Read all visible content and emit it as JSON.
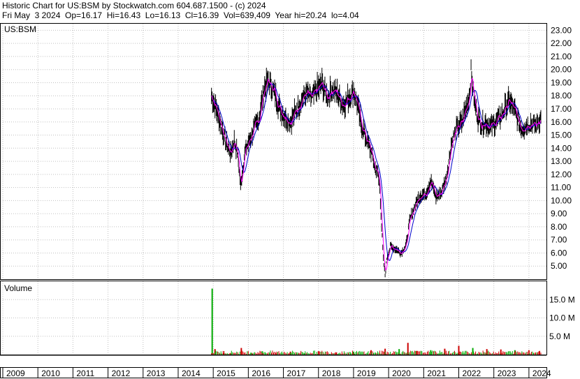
{
  "header": {
    "line1": "Historic Chart for US:BSM by Stockwatch.com 604.687.1500 - (c) 2024",
    "line2": "Fri May  3 2024  Op=16.17  Hi=16.43  Lo=16.13  Cl=16.39  Vol=639,409  Year hi=20.24  lo=4.04"
  },
  "colors": {
    "background": "#ffffff",
    "grid": "#c0c0c0",
    "price_bars": "#000000",
    "ma_short": "#ff00ff",
    "ma_long": "#0000cc",
    "volume_up": "#00aa00",
    "volume_down": "#cc0000"
  },
  "chart_data": [
    {
      "type": "line",
      "title": "US:BSM",
      "ylim": [
        4.0,
        23.5
      ],
      "y_ticks": [
        "23.00",
        "22.00",
        "21.00",
        "20.00",
        "19.00",
        "18.00",
        "17.00",
        "16.00",
        "15.00",
        "14.00",
        "13.00",
        "12.00",
        "11.00",
        "10.00",
        "9.00",
        "8.00",
        "7.00",
        "6.00",
        "5.00"
      ],
      "x_ticks": [
        "2009",
        "2010",
        "2011",
        "2012",
        "2013",
        "2014",
        "2015",
        "2016",
        "2017",
        "2018",
        "2019",
        "2020",
        "2021",
        "2022",
        "2023",
        "2024"
      ],
      "grid": true,
      "series_points": [
        [
          2014.95,
          18.0
        ],
        [
          2015.05,
          17.3
        ],
        [
          2015.2,
          16.0
        ],
        [
          2015.35,
          14.5
        ],
        [
          2015.5,
          13.6
        ],
        [
          2015.6,
          14.6
        ],
        [
          2015.7,
          13.5
        ],
        [
          2015.78,
          11.1
        ],
        [
          2015.9,
          13.7
        ],
        [
          2016.0,
          14.4
        ],
        [
          2016.15,
          15.4
        ],
        [
          2016.3,
          16.2
        ],
        [
          2016.45,
          18.5
        ],
        [
          2016.55,
          19.1
        ],
        [
          2016.65,
          18.8
        ],
        [
          2016.75,
          18.2
        ],
        [
          2016.9,
          17.0
        ],
        [
          2017.05,
          16.4
        ],
        [
          2017.2,
          16.0
        ],
        [
          2017.35,
          16.8
        ],
        [
          2017.5,
          17.6
        ],
        [
          2017.65,
          18.2
        ],
        [
          2017.8,
          17.8
        ],
        [
          2017.95,
          18.4
        ],
        [
          2018.1,
          18.9
        ],
        [
          2018.25,
          17.9
        ],
        [
          2018.4,
          18.5
        ],
        [
          2018.55,
          18.1
        ],
        [
          2018.7,
          17.3
        ],
        [
          2018.85,
          17.8
        ],
        [
          2019.0,
          18.4
        ],
        [
          2019.1,
          17.5
        ],
        [
          2019.2,
          16.0
        ],
        [
          2019.35,
          14.8
        ],
        [
          2019.5,
          13.8
        ],
        [
          2019.6,
          12.6
        ],
        [
          2019.7,
          12.0
        ],
        [
          2019.75,
          11.0
        ],
        [
          2019.8,
          8.0
        ],
        [
          2019.85,
          5.5
        ],
        [
          2019.9,
          4.3
        ],
        [
          2019.95,
          5.6
        ],
        [
          2020.05,
          6.5
        ],
        [
          2020.2,
          6.3
        ],
        [
          2020.35,
          6.0
        ],
        [
          2020.5,
          6.6
        ],
        [
          2020.6,
          8.5
        ],
        [
          2020.75,
          9.6
        ],
        [
          2020.9,
          10.4
        ],
        [
          2021.05,
          10.5
        ],
        [
          2021.2,
          11.5
        ],
        [
          2021.35,
          10.3
        ],
        [
          2021.5,
          10.6
        ],
        [
          2021.65,
          11.8
        ],
        [
          2021.8,
          14.5
        ],
        [
          2021.95,
          15.5
        ],
        [
          2022.1,
          16.0
        ],
        [
          2022.2,
          17.0
        ],
        [
          2022.3,
          18.0
        ],
        [
          2022.35,
          19.8
        ],
        [
          2022.45,
          17.5
        ],
        [
          2022.55,
          16.3
        ],
        [
          2022.65,
          15.8
        ],
        [
          2022.75,
          16.0
        ],
        [
          2022.9,
          15.6
        ],
        [
          2023.05,
          16.0
        ],
        [
          2023.2,
          16.4
        ],
        [
          2023.35,
          17.2
        ],
        [
          2023.45,
          17.6
        ],
        [
          2023.6,
          16.8
        ],
        [
          2023.7,
          16.0
        ],
        [
          2023.8,
          15.5
        ],
        [
          2023.95,
          15.8
        ],
        [
          2024.05,
          15.9
        ],
        [
          2024.2,
          15.7
        ],
        [
          2024.34,
          16.39
        ]
      ]
    },
    {
      "type": "bar",
      "title": "Volume",
      "ylim": [
        0,
        20000000
      ],
      "y_ticks": [
        "15.0 M",
        "10.0 M",
        "5.0 M"
      ],
      "series_points": [
        [
          2014.97,
          18000000
        ],
        [
          2015.05,
          1500000
        ],
        [
          2015.3,
          400000
        ],
        [
          2015.5,
          300000
        ],
        [
          2015.8,
          1800000
        ],
        [
          2016.1,
          400000
        ],
        [
          2016.4,
          900000
        ],
        [
          2016.8,
          300000
        ],
        [
          2017.2,
          800000
        ],
        [
          2017.6,
          300000
        ],
        [
          2018.0,
          900000
        ],
        [
          2018.5,
          500000
        ],
        [
          2019.0,
          800000
        ],
        [
          2019.5,
          1200000
        ],
        [
          2019.9,
          1600000
        ],
        [
          2020.3,
          1500000
        ],
        [
          2020.55,
          3200000
        ],
        [
          2020.8,
          1000000
        ],
        [
          2021.2,
          1200000
        ],
        [
          2021.6,
          1600000
        ],
        [
          2022.0,
          2400000
        ],
        [
          2022.4,
          1800000
        ],
        [
          2022.8,
          1500000
        ],
        [
          2023.2,
          1400000
        ],
        [
          2023.6,
          1200000
        ],
        [
          2024.0,
          1200000
        ],
        [
          2024.3,
          900000
        ]
      ]
    }
  ]
}
